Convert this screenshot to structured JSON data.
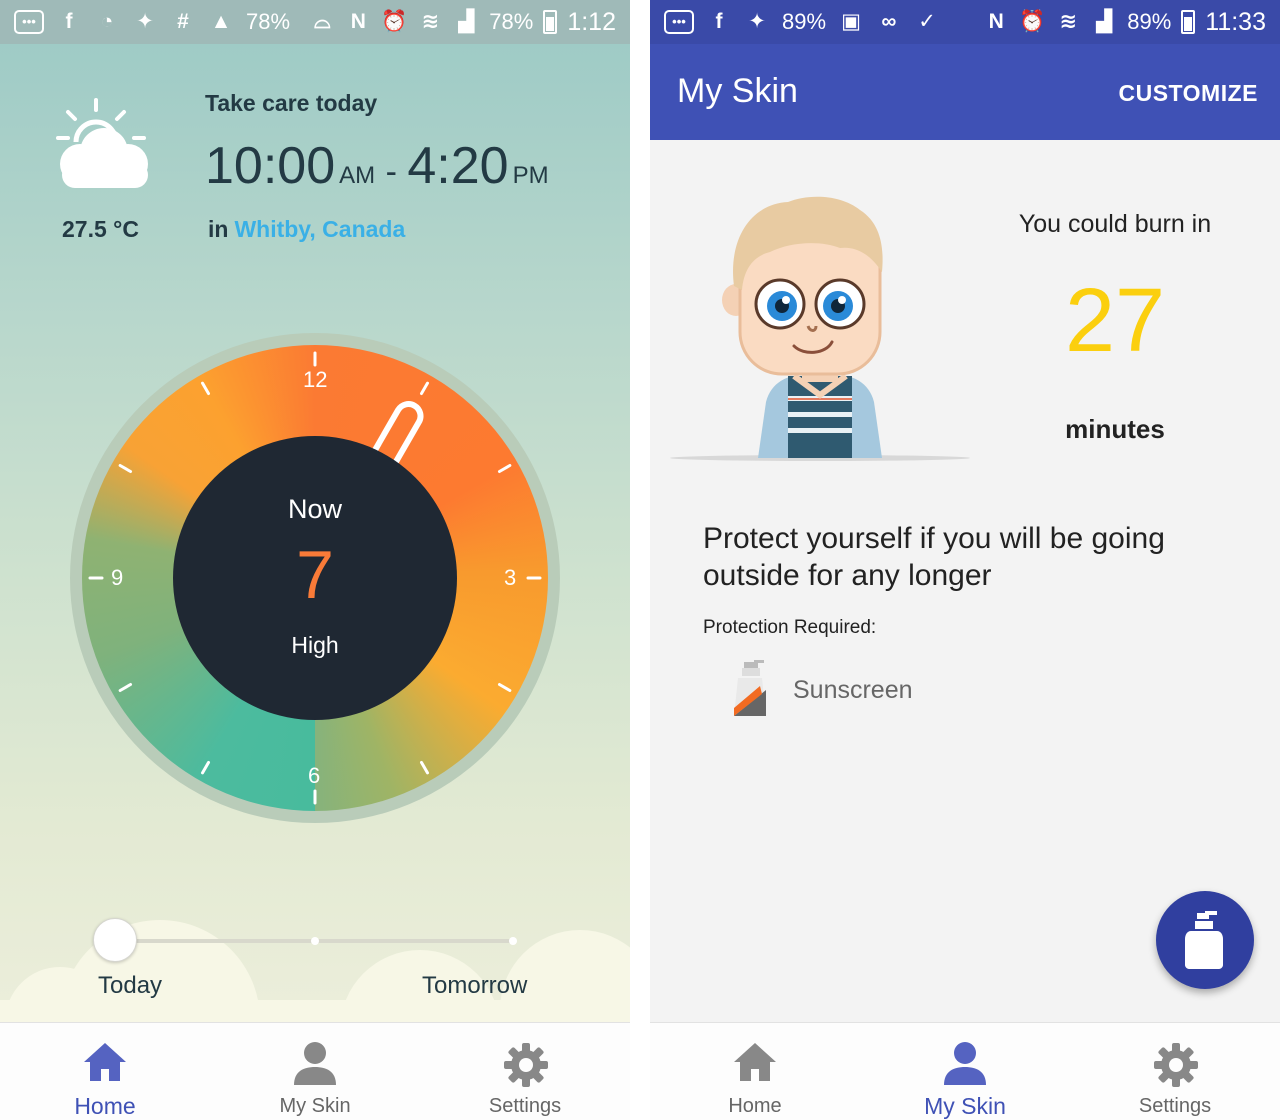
{
  "left": {
    "status_bar": {
      "app_icons": [
        "message-icon",
        "facebook-icon",
        "messenger-icon",
        "twitter-icon",
        "slack-icon",
        "drive-icon"
      ],
      "left_battery": "78%",
      "battery": "78%",
      "time": "1:12"
    },
    "weather": {
      "icon": "partly-sunny-icon",
      "temperature": "27.5 °C"
    },
    "care": {
      "title": "Take care today",
      "start_time": "10:00",
      "start_period": "AM",
      "separator": "-",
      "end_time": "4:20",
      "end_period": "PM",
      "location_prefix": "in",
      "location": "Whitby, Canada"
    },
    "uv_dial": {
      "now_label": "Now",
      "uv_index": "7",
      "level": "High",
      "hour_labels": {
        "top": "12",
        "right": "3",
        "bottom": "6",
        "left": "9"
      },
      "colors": {
        "high": "#fb7a33",
        "moderate": "#fbab30",
        "low": "#86b37c",
        "night": "#48bb9d",
        "center": "#1f2833"
      }
    },
    "day_slider": {
      "start_label": "Today",
      "end_label": "Tomorrow"
    },
    "bottom_nav": [
      {
        "label": "Home",
        "icon": "home-icon",
        "active": true
      },
      {
        "label": "My Skin",
        "icon": "person-icon",
        "active": false
      },
      {
        "label": "Settings",
        "icon": "gear-icon",
        "active": false
      }
    ]
  },
  "right": {
    "status_bar": {
      "app_icons": [
        "message-icon",
        "facebook-icon",
        "twitter-icon"
      ],
      "left_battery": "89%",
      "battery": "89%",
      "time": "11:33"
    },
    "app_bar": {
      "title": "My Skin",
      "action": "CUSTOMIZE",
      "color": "#3f51b5"
    },
    "burn": {
      "caption": "You could burn in",
      "value": "27",
      "unit": "minutes",
      "value_color": "#fbcf0e"
    },
    "advice": "Protect yourself if you will be going outside for any longer",
    "protection": {
      "label": "Protection Required:",
      "items": [
        {
          "label": "Sunscreen",
          "icon": "sunscreen-icon"
        }
      ]
    },
    "fab_icon": "sunscreen-bottle-icon",
    "bottom_nav": [
      {
        "label": "Home",
        "icon": "home-icon",
        "active": false
      },
      {
        "label": "My Skin",
        "icon": "person-icon",
        "active": true
      },
      {
        "label": "Settings",
        "icon": "gear-icon",
        "active": false
      }
    ]
  }
}
